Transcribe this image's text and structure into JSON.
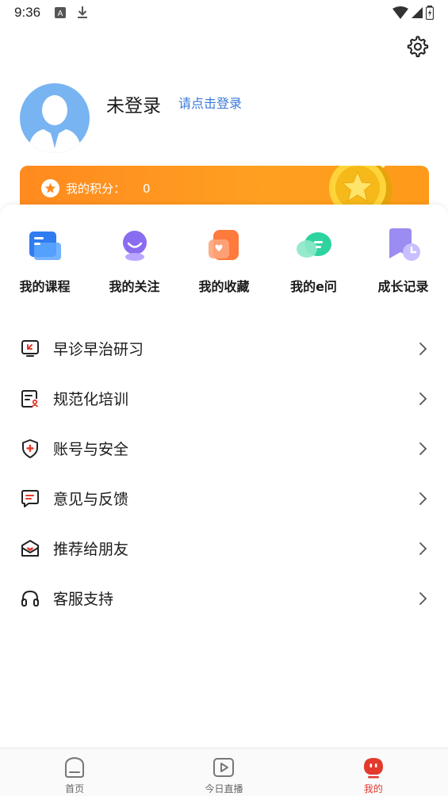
{
  "status_bar": {
    "time": "9:36"
  },
  "profile": {
    "name": "未登录",
    "login_prompt": "请点击登录"
  },
  "points": {
    "label": "我的积分：",
    "value": "0"
  },
  "shortcuts": [
    {
      "label": "我的课程",
      "icon": "course-icon",
      "color": "#2f7df0"
    },
    {
      "label": "我的关注",
      "icon": "follow-icon",
      "color": "#8a6cf0"
    },
    {
      "label": "我的收藏",
      "icon": "favorite-icon",
      "color": "#ff7a3d"
    },
    {
      "label": "我的e问",
      "icon": "question-icon",
      "color": "#2ed3a0"
    },
    {
      "label": "成长记录",
      "icon": "growth-record-icon",
      "color": "#9a8cf0"
    }
  ],
  "menu": [
    {
      "label": "早诊早治研习",
      "icon": "study-icon"
    },
    {
      "label": "规范化培训",
      "icon": "training-icon"
    },
    {
      "label": "账号与安全",
      "icon": "shield-icon"
    },
    {
      "label": "意见与反馈",
      "icon": "feedback-icon"
    },
    {
      "label": "推荐给朋友",
      "icon": "recommend-icon"
    },
    {
      "label": "客服支持",
      "icon": "headset-icon"
    }
  ],
  "tabs": [
    {
      "label": "首页",
      "icon": "home-icon",
      "active": false
    },
    {
      "label": "今日直播",
      "icon": "live-icon",
      "active": false
    },
    {
      "label": "我的",
      "icon": "mine-icon",
      "active": true
    }
  ],
  "colors": {
    "accent": "#e33a2e",
    "banner": "#ff9a1a",
    "link": "#3b78d8",
    "avatar": "#79b4f2"
  }
}
